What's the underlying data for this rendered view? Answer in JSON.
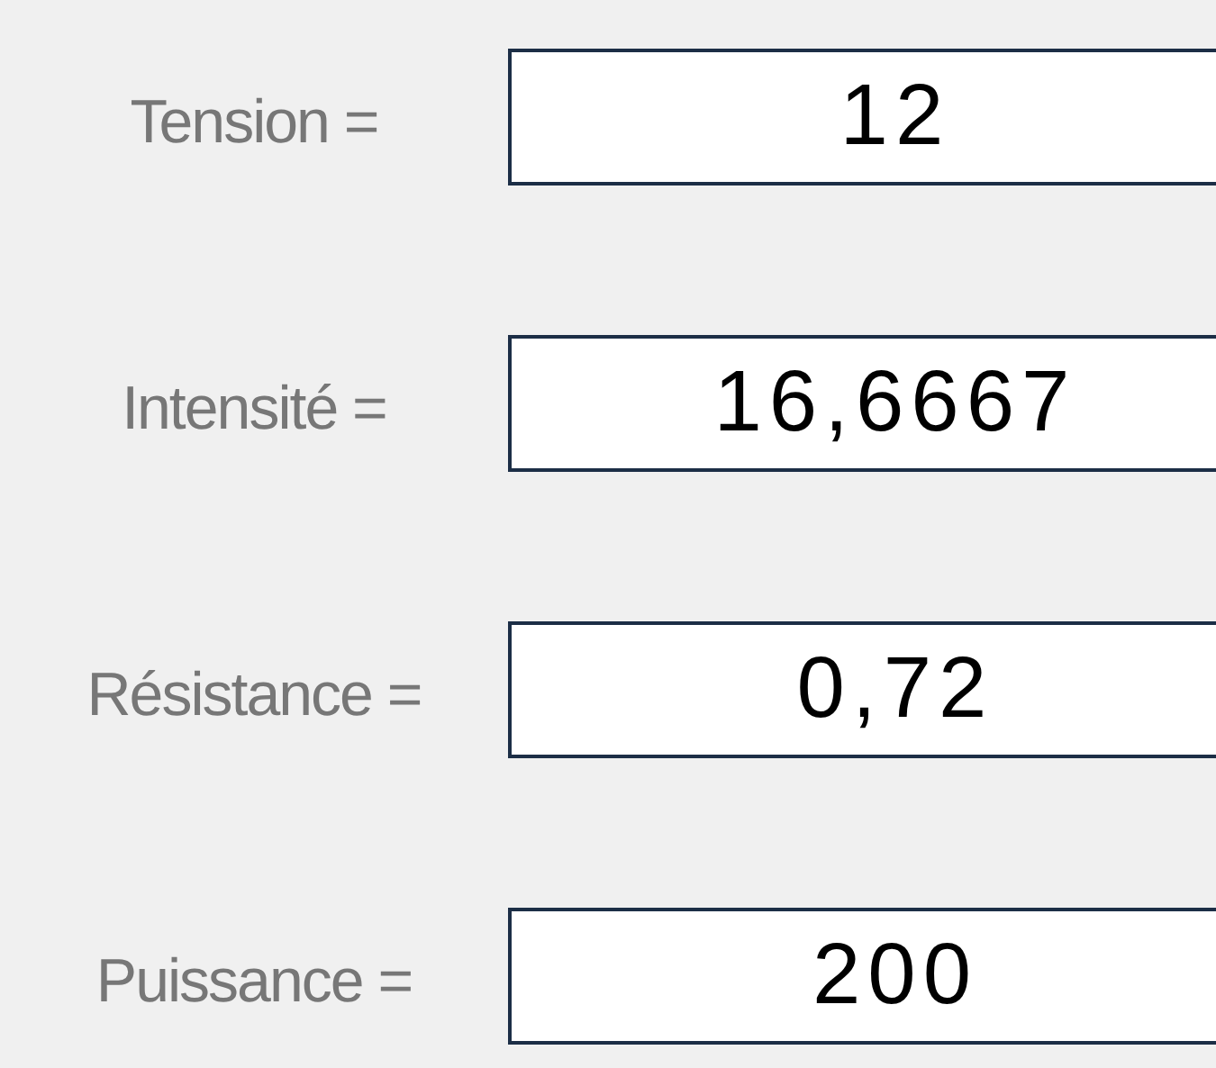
{
  "fields": [
    {
      "label": "Tension =",
      "value": "12"
    },
    {
      "label": "Intensité =",
      "value": "16,6667"
    },
    {
      "label": "Résistance =",
      "value": "0,72"
    },
    {
      "label": "Puissance =",
      "value": "200"
    }
  ]
}
